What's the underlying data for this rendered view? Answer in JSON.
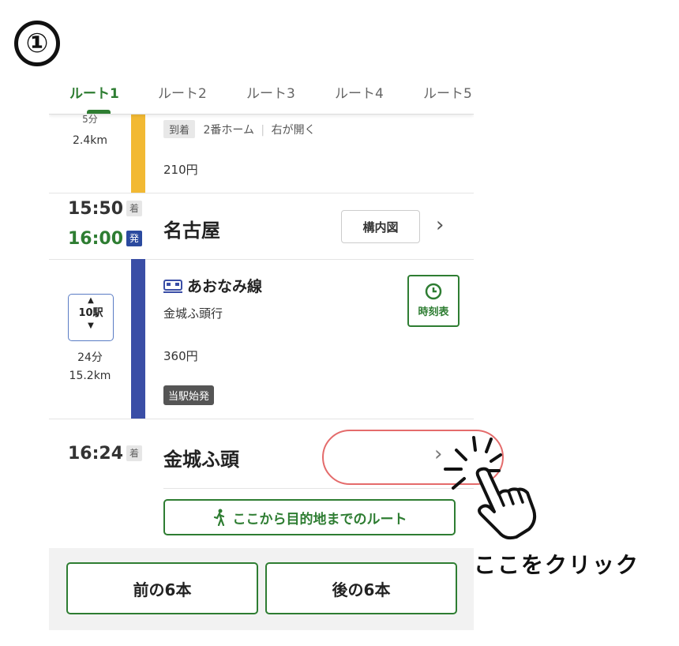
{
  "step_label": "①",
  "tabs": [
    "ルート1",
    "ルート2",
    "ルート3",
    "ルート4",
    "ルート5"
  ],
  "segment1": {
    "duration": "5分",
    "distance": "2.4km",
    "arrival_chip": "到着",
    "platform": "2番ホーム",
    "door": "右が開く",
    "fare": "210円"
  },
  "nagoya": {
    "arrive_time": "15:50",
    "arrive_mark": "着",
    "depart_time": "16:00",
    "depart_mark": "発",
    "name": "名古屋",
    "map_button": "構内図",
    "chevron": "›"
  },
  "segment2": {
    "line_name": "あおなみ線",
    "direction": "金城ふ頭行",
    "stops": "10駅",
    "duration": "24分",
    "distance": "15.2km",
    "fare": "360円",
    "origin_badge": "当駅始発",
    "timetable_label": "時刻表"
  },
  "kinjo": {
    "arrive_time": "16:24",
    "arrive_mark": "着",
    "name": "金城ふ頭",
    "chevron": "›"
  },
  "walk_button": "ここから目的地までのルート",
  "prev_button": "前の6本",
  "next_button": "後の6本",
  "callout_text": "ここをクリック",
  "colors": {
    "accent_green": "#2e7d32",
    "line_yellow": "#f2b933",
    "line_blue": "#3a4ea6",
    "highlight_red": "#e46b6b"
  }
}
